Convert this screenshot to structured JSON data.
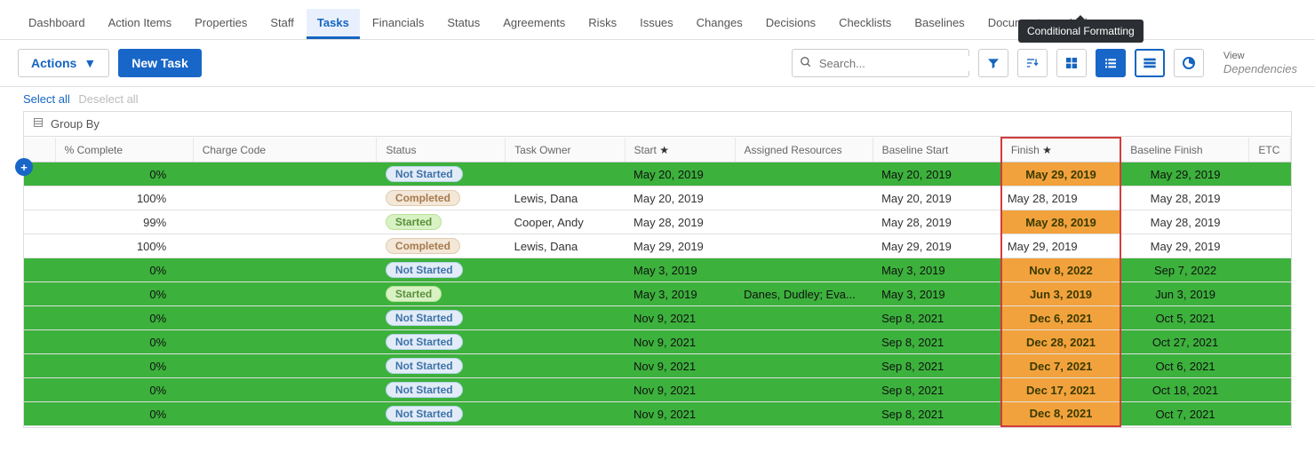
{
  "tabs": [
    "Dashboard",
    "Action Items",
    "Properties",
    "Staff",
    "Tasks",
    "Financials",
    "Status",
    "Agreements",
    "Risks",
    "Issues",
    "Changes",
    "Decisions",
    "Checklists",
    "Baselines",
    "",
    "Documents",
    "Links"
  ],
  "active_tab_index": 4,
  "tooltip": "Conditional Formatting",
  "toolbar": {
    "actions_label": "Actions",
    "new_task_label": "New Task",
    "search_placeholder": "Search...",
    "view_label": "View",
    "view_value": "Dependencies"
  },
  "select_bar": {
    "select_all": "Select all",
    "deselect_all": "Deselect all"
  },
  "groupby_label": "Group By",
  "columns": [
    "",
    "% Complete",
    "Charge Code",
    "Status",
    "Task Owner",
    "Start ★",
    "Assigned Resources",
    "Baseline Start",
    "Finish ★",
    "Baseline Finish",
    "ETC"
  ],
  "rows": [
    {
      "green": true,
      "complete": "0%",
      "status": "Not Started",
      "owner": "",
      "start": "May 20, 2019",
      "assigned": "",
      "baseline_start": "May 20, 2019",
      "finish": "May 29, 2019",
      "finish_hl": true,
      "baseline_finish": "May 29, 2019"
    },
    {
      "green": false,
      "complete": "100%",
      "status": "Completed",
      "owner": "Lewis, Dana",
      "start": "May 20, 2019",
      "assigned": "",
      "baseline_start": "May 20, 2019",
      "finish": "May 28, 2019",
      "finish_hl": false,
      "baseline_finish": "May 28, 2019"
    },
    {
      "green": false,
      "complete": "99%",
      "status": "Started",
      "owner": "Cooper, Andy",
      "start": "May 28, 2019",
      "assigned": "",
      "baseline_start": "May 28, 2019",
      "finish": "May 28, 2019",
      "finish_hl": true,
      "baseline_finish": "May 28, 2019"
    },
    {
      "green": false,
      "complete": "100%",
      "status": "Completed",
      "owner": "Lewis, Dana",
      "start": "May 29, 2019",
      "assigned": "",
      "baseline_start": "May 29, 2019",
      "finish": "May 29, 2019",
      "finish_hl": false,
      "baseline_finish": "May 29, 2019"
    },
    {
      "green": true,
      "complete": "0%",
      "status": "Not Started",
      "owner": "",
      "start": "May 3, 2019",
      "assigned": "",
      "baseline_start": "May 3, 2019",
      "finish": "Nov 8, 2022",
      "finish_hl": true,
      "baseline_finish": "Sep 7, 2022"
    },
    {
      "green": true,
      "complete": "0%",
      "status": "Started",
      "owner": "",
      "start": "May 3, 2019",
      "assigned": "Danes, Dudley; Eva...",
      "baseline_start": "May 3, 2019",
      "finish": "Jun 3, 2019",
      "finish_hl": true,
      "baseline_finish": "Jun 3, 2019"
    },
    {
      "green": true,
      "complete": "0%",
      "status": "Not Started",
      "owner": "",
      "start": "Nov 9, 2021",
      "assigned": "",
      "baseline_start": "Sep 8, 2021",
      "finish": "Dec 6, 2021",
      "finish_hl": true,
      "baseline_finish": "Oct 5, 2021"
    },
    {
      "green": true,
      "complete": "0%",
      "status": "Not Started",
      "owner": "",
      "start": "Nov 9, 2021",
      "assigned": "",
      "baseline_start": "Sep 8, 2021",
      "finish": "Dec 28, 2021",
      "finish_hl": true,
      "baseline_finish": "Oct 27, 2021"
    },
    {
      "green": true,
      "complete": "0%",
      "status": "Not Started",
      "owner": "",
      "start": "Nov 9, 2021",
      "assigned": "",
      "baseline_start": "Sep 8, 2021",
      "finish": "Dec 7, 2021",
      "finish_hl": true,
      "baseline_finish": "Oct 6, 2021"
    },
    {
      "green": true,
      "complete": "0%",
      "status": "Not Started",
      "owner": "",
      "start": "Nov 9, 2021",
      "assigned": "",
      "baseline_start": "Sep 8, 2021",
      "finish": "Dec 17, 2021",
      "finish_hl": true,
      "baseline_finish": "Oct 18, 2021"
    },
    {
      "green": true,
      "complete": "0%",
      "status": "Not Started",
      "owner": "",
      "start": "Nov 9, 2021",
      "assigned": "",
      "baseline_start": "Sep 8, 2021",
      "finish": "Dec 8, 2021",
      "finish_hl": true,
      "baseline_finish": "Oct 7, 2021"
    }
  ],
  "status_pill_class": {
    "Not Started": "pill-notstarted",
    "Completed": "pill-completed",
    "Started": "pill-started"
  }
}
